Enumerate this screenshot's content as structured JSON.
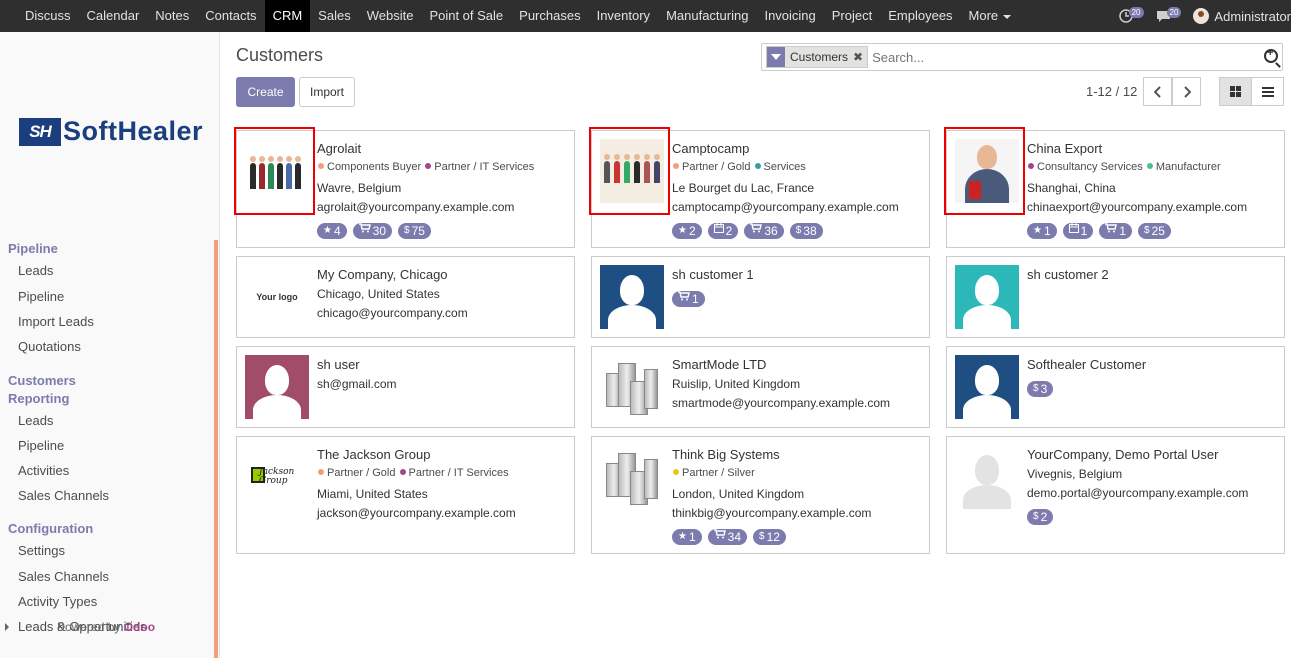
{
  "topbar": {
    "menu": [
      "Discuss",
      "Calendar",
      "Notes",
      "Contacts",
      "CRM",
      "Sales",
      "Website",
      "Point of Sale",
      "Purchases",
      "Inventory",
      "Manufacturing",
      "Invoicing",
      "Project",
      "Employees",
      "More"
    ],
    "active": "CRM",
    "messages_count": "20",
    "activities_count": "20",
    "user_name": "Administrator"
  },
  "sidebar": {
    "logo_mark": "SH",
    "logo_text": "SoftHealer",
    "sections": [
      {
        "title": "Pipeline",
        "items": [
          "Leads",
          "Pipeline",
          "Import Leads",
          "Quotations"
        ]
      },
      {
        "title": "Customers Reporting",
        "items": [
          "Leads",
          "Pipeline",
          "Activities",
          "Sales Channels"
        ]
      },
      {
        "title": "Configuration",
        "items": [
          "Settings",
          "Sales Channels",
          "Activity Types",
          "Leads & Opportunities"
        ]
      }
    ],
    "powered_prefix": "Powered by",
    "powered_brand": "Odoo"
  },
  "control": {
    "title": "Customers",
    "create_label": "Create",
    "import_label": "Import",
    "facet_label": "Customers",
    "search_placeholder": "Search...",
    "pager": "1-12 / 12"
  },
  "colors": {
    "accent": "#7c7bad",
    "highlight": "#e00000",
    "topbar": "#2f2f2f"
  },
  "cards": [
    {
      "name": "Agrolait",
      "tags": [
        {
          "label": "Components Buyer",
          "color": "#f0a07a"
        },
        {
          "label": "Partner / IT Services",
          "color": "#a24689"
        }
      ],
      "location": "Wavre, Belgium",
      "email": "agrolait@yourcompany.example.com",
      "badges": [
        {
          "icon": "★",
          "value": "4"
        },
        {
          "icon": "🛒",
          "value": "30"
        },
        {
          "icon": "$",
          "value": "75"
        }
      ],
      "image": "people",
      "highlighted": true
    },
    {
      "name": "Camptocamp",
      "tags": [
        {
          "label": "Partner / Gold",
          "color": "#f0a07a"
        },
        {
          "label": "Services",
          "color": "#30a0a8"
        }
      ],
      "location": "Le Bourget du Lac, France",
      "email": "camptocamp@yourcompany.example.com",
      "badges": [
        {
          "icon": "★",
          "value": "2"
        },
        {
          "icon": "📅",
          "value": "2"
        },
        {
          "icon": "🛒",
          "value": "36"
        },
        {
          "icon": "$",
          "value": "38"
        }
      ],
      "image": "team",
      "highlighted": true
    },
    {
      "name": "China Export",
      "tags": [
        {
          "label": "Consultancy Services",
          "color": "#a24689"
        },
        {
          "label": "Manufacturer",
          "color": "#4cc08a"
        }
      ],
      "location": "Shanghai, China",
      "email": "chinaexport@yourcompany.example.com",
      "badges": [
        {
          "icon": "★",
          "value": "1"
        },
        {
          "icon": "📅",
          "value": "1"
        },
        {
          "icon": "🛒",
          "value": "1"
        },
        {
          "icon": "$",
          "value": "25"
        }
      ],
      "image": "businessman",
      "highlighted": true
    },
    {
      "name": "My Company, Chicago",
      "tags": [],
      "location": "Chicago, United States",
      "email": "chicago@yourcompany.com",
      "badges": [],
      "image": "yourlogo",
      "logo_text": "Your logo",
      "highlighted": false
    },
    {
      "name": "sh customer 1",
      "tags": [],
      "location": "",
      "email": "",
      "badges": [
        {
          "icon": "🛒",
          "value": "1"
        }
      ],
      "image": "avatar",
      "avatar_bg": "#1f4f82",
      "highlighted": false
    },
    {
      "name": "sh customer 2",
      "tags": [],
      "location": "",
      "email": "",
      "badges": [],
      "image": "avatar",
      "avatar_bg": "#2cb8b8",
      "highlighted": false
    },
    {
      "name": "sh user",
      "tags": [],
      "location": "sh@gmail.com",
      "email": "",
      "badges": [],
      "image": "avatar",
      "avatar_bg": "#a14d69",
      "highlighted": false
    },
    {
      "name": "SmartMode LTD",
      "tags": [],
      "location": "Ruislip, United Kingdom",
      "email": "smartmode@yourcompany.example.com",
      "badges": [],
      "image": "building",
      "highlighted": false
    },
    {
      "name": "Softhealer Customer",
      "tags": [],
      "location": "",
      "email": "",
      "badges": [
        {
          "icon": "$",
          "value": "3"
        }
      ],
      "image": "avatar",
      "avatar_bg": "#1f4f82",
      "highlighted": false
    },
    {
      "name": "The Jackson Group",
      "tags": [
        {
          "label": "Partner / Gold",
          "color": "#f0a07a"
        },
        {
          "label": "Partner / IT Services",
          "color": "#a24689"
        }
      ],
      "location": "Miami, United States",
      "email": "jackson@yourcompany.example.com",
      "badges": [],
      "image": "jackson",
      "logo_text": "Jackson Group",
      "highlighted": false
    },
    {
      "name": "Think Big Systems",
      "tags": [
        {
          "label": "Partner / Silver",
          "color": "#e8c619"
        }
      ],
      "location": "London, United Kingdom",
      "email": "thinkbig@yourcompany.example.com",
      "badges": [
        {
          "icon": "★",
          "value": "1"
        },
        {
          "icon": "🛒",
          "value": "34"
        },
        {
          "icon": "$",
          "value": "12"
        }
      ],
      "image": "building",
      "highlighted": false
    },
    {
      "name": "YourCompany, Demo Portal User",
      "tags": [],
      "location": "Vivegnis, Belgium",
      "email": "demo.portal@yourcompany.example.com",
      "badges": [
        {
          "icon": "$",
          "value": "2"
        }
      ],
      "image": "avatar",
      "avatar_bg": "#ffffff",
      "highlighted": false
    }
  ]
}
